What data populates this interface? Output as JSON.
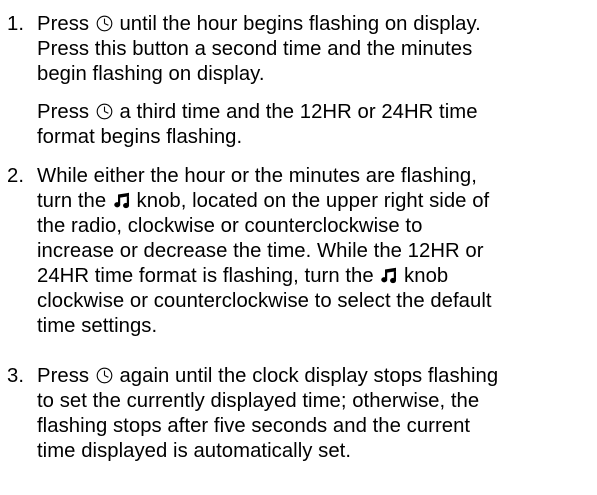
{
  "icons": {
    "clock": "clock-icon",
    "music_note": "music-note-icon"
  },
  "steps": [
    {
      "number": "1.",
      "lines": [
        [
          "Press ",
          {
            "icon": "clock"
          },
          " until the hour begins flashing on display."
        ],
        [
          "Press this button a second time and the minutes"
        ],
        [
          "begin flashing on display."
        ]
      ],
      "sub_paragraph": [
        [
          "Press ",
          {
            "icon": "clock"
          },
          " a third time and the 12HR or 24HR time"
        ],
        [
          "format begins flashing."
        ]
      ]
    },
    {
      "number": "2.",
      "lines": [
        [
          "While either the hour or the minutes are flashing,"
        ],
        [
          "turn the ",
          {
            "icon": "music_note"
          },
          " knob, located on the upper right side of"
        ],
        [
          "the radio, clockwise or counterclockwise to"
        ],
        [
          "increase or decrease the time. While the 12HR or"
        ],
        [
          "24HR time format is flashing, turn the ",
          {
            "icon": "music_note"
          },
          " knob"
        ],
        [
          "clockwise or counterclockwise to select the default"
        ],
        [
          "time settings."
        ]
      ]
    },
    {
      "number": "3.",
      "lines": [
        [
          "Press ",
          {
            "icon": "clock"
          },
          " again until the clock display stops flashing"
        ],
        [
          "to set the currently displayed time; otherwise, the"
        ],
        [
          "flashing stops after five seconds and the current"
        ],
        [
          "time displayed is automatically set."
        ]
      ]
    }
  ]
}
